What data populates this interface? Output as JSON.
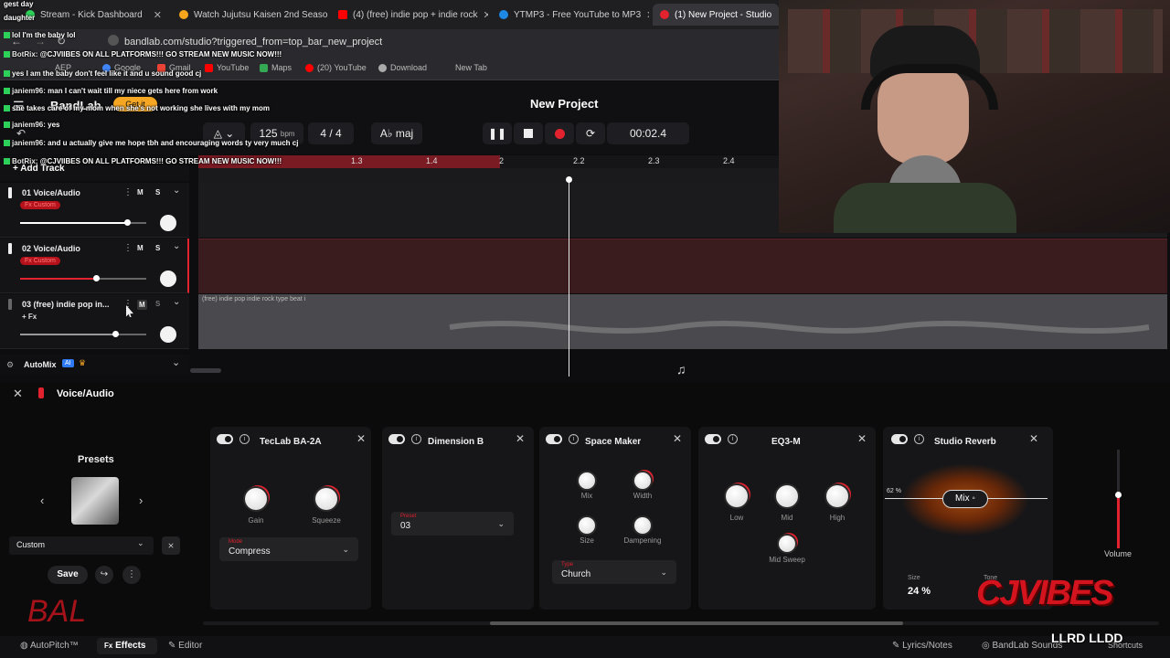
{
  "browser": {
    "tabs": [
      {
        "label": "Stream - Kick Dashboard",
        "color": "#2dd15a"
      },
      {
        "label": "Watch Jujutsu Kaisen 2nd Seaso",
        "color": "#f4a51c"
      },
      {
        "label": "(4) (free) indie pop + indie rock",
        "color": "#ff0000"
      },
      {
        "label": "YTMP3 - Free YouTube to MP3",
        "color": "#1e88e5"
      },
      {
        "label": "(1) New Project - Studio",
        "color": "#e2222e"
      }
    ],
    "url": "bandlab.com/studio?triggered_from=top_bar_new_project",
    "bookmarks": [
      "AEP",
      "Google",
      "Gmail",
      "YouTube",
      "Maps",
      "(20) YouTube",
      "Download",
      "New Tab"
    ]
  },
  "chat": [
    {
      "user": "",
      "msg": "gest day"
    },
    {
      "user": "",
      "msg": "daughter"
    },
    {
      "user": "",
      "msg": "lol I'm the baby lol"
    },
    {
      "user": "BotRix:",
      "msg": "@CJVIIBES ON ALL PLATFORMS!!! GO STREAM NEW MUSIC NOW!!!"
    },
    {
      "user": "",
      "msg": "yes I am the baby don't feel like it and u sound good cj"
    },
    {
      "user": "janiem96:",
      "msg": "man I can't wait till my niece gets here from work"
    },
    {
      "user": "",
      "msg": "she takes care of my mom when she's not working she lives with my mom"
    },
    {
      "user": "janiem96:",
      "msg": "yes"
    },
    {
      "user": "janiem96:",
      "msg": "and u actually give me hope tbh and encouraging words ty very much cj"
    },
    {
      "user": "BotRix:",
      "msg": "@CJVIIBES ON ALL PLATFORMS!!! GO STREAM NEW MUSIC NOW!!!"
    }
  ],
  "app": {
    "brand": "BandLab",
    "get_label": "Get it",
    "project_title": "New Project",
    "add_track": "Add Track",
    "bpm": "125",
    "bpm_unit": "bpm",
    "time_sig": "4 / 4",
    "key": "A♭ maj",
    "time": "00:02.4",
    "ruler": [
      "1.3",
      "1.4",
      "2",
      "2.2",
      "2.3",
      "2.4"
    ]
  },
  "tracks": [
    {
      "name": "01  Voice/Audio",
      "fx": "Fx Custom",
      "mute": "M",
      "solo": "S",
      "volume": 0.85,
      "color": "#ffffff"
    },
    {
      "name": "02  Voice/Audio",
      "fx": "Fx Custom",
      "mute": "M",
      "solo": "S",
      "volume": 0.6,
      "color": "#e2222e"
    },
    {
      "name": "03  (free) indie pop  in...",
      "fx": "+ Fx",
      "mute": "M",
      "solo": "S",
      "volume": 0.75,
      "color": "#999999"
    }
  ],
  "region_label": "(free) indie pop  indie rock type beat i",
  "automix": {
    "label": "AutoMix",
    "badge": "AI"
  },
  "fx": {
    "track_label": "Voice/Audio",
    "presets": {
      "title": "Presets",
      "selected": "Custom",
      "save": "Save"
    },
    "cards": [
      {
        "name": "TecLab BA-2A",
        "knobs": [
          "Gain",
          "Squeeze"
        ],
        "select_caption": "Mode",
        "select_value": "Compress"
      },
      {
        "name": "Dimension B",
        "select_caption": "Preset",
        "select_value": "03"
      },
      {
        "name": "Space Maker",
        "knobs": [
          "Mix",
          "Width",
          "Size",
          "Dampening"
        ],
        "select_caption": "Type",
        "select_value": "Church"
      },
      {
        "name": "EQ3-M",
        "knobs": [
          "Low",
          "Mid",
          "High",
          "Mid Sweep"
        ]
      },
      {
        "name": "Studio Reverb",
        "mix_label": "Mix",
        "mix_value": "62 %",
        "size_label": "Size",
        "size_value": "24 %",
        "tone_label": "Tone"
      }
    ],
    "volume_label": "Volume",
    "volume_level": 0.55
  },
  "bottom": {
    "autopitch": "AutoPitch™",
    "effects": "Effects",
    "editor": "Editor",
    "lyrics": "Lyrics/Notes",
    "sounds": "BandLab Sounds",
    "shortcuts": "Shortcuts"
  },
  "overlay": {
    "logo": "CJVIBES",
    "sub": "LLRD LLDD",
    "sig": "BAL"
  }
}
